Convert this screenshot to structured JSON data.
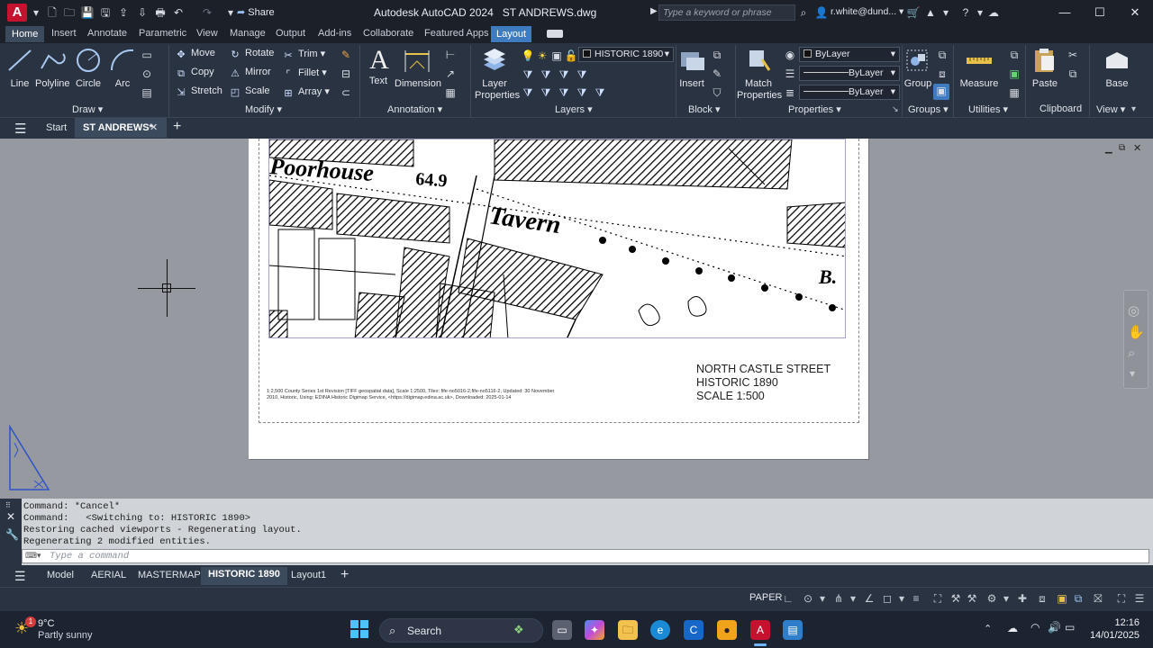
{
  "app": {
    "title": "Autodesk AutoCAD 2024",
    "filename": "ST ANDREWS.dwg",
    "logo_letter": "A",
    "share_label": "Share",
    "search_placeholder": "Type a keyword or phrase",
    "user": "r.white@dund..."
  },
  "ribbon_tabs": [
    "Home",
    "Insert",
    "Annotate",
    "Parametric",
    "View",
    "Manage",
    "Output",
    "Add-ins",
    "Collaborate",
    "Featured Apps",
    "Layout"
  ],
  "ribbon": {
    "draw": {
      "label": "Draw",
      "line": "Line",
      "polyline": "Polyline",
      "circle": "Circle",
      "arc": "Arc"
    },
    "modify": {
      "label": "Modify",
      "move": "Move",
      "rotate": "Rotate",
      "trim": "Trim",
      "copy": "Copy",
      "mirror": "Mirror",
      "fillet": "Fillet",
      "stretch": "Stretch",
      "scale": "Scale",
      "array": "Array"
    },
    "annotation": {
      "label": "Annotation",
      "text": "Text",
      "dimension": "Dimension"
    },
    "layers": {
      "label": "Layers",
      "layer_properties": "Layer Properties",
      "current_layer": "HISTORIC 1890"
    },
    "block": {
      "label": "Block",
      "insert": "Insert"
    },
    "properties": {
      "label": "Properties",
      "match": "Match Properties",
      "color": "ByLayer",
      "linetype": "ByLayer",
      "lineweight": "ByLayer"
    },
    "groups": {
      "label": "Groups",
      "group": "Group"
    },
    "utilities": {
      "label": "Utilities",
      "measure": "Measure"
    },
    "clipboard": {
      "label": "Clipboard",
      "paste": "Paste"
    },
    "view": {
      "label": "View",
      "base": "Base"
    }
  },
  "doc_tabs": {
    "start": "Start",
    "current": "ST ANDREWS*"
  },
  "map": {
    "poorhouse": "Poorhouse",
    "spot_height": "64.9",
    "tavern": "Tavern",
    "b_label": "B."
  },
  "sheet": {
    "credit_line1": "1:2,500 County Series 1st Revision [TIFF geospatial data], Scale 1:2500, Tiles: fife-no5016-2,fife-no5116-2, Updated: 30 November",
    "credit_line2": "2010, Historic, Using: EDINA Historic Digimap Service, <https://digimap.edina.ac.uk>, Downloaded: 2025-01-14",
    "title1": "NORTH CASTLE STREET",
    "title2": "HISTORIC 1890",
    "title3": "SCALE 1:500"
  },
  "command": {
    "history": [
      "Command: *Cancel*",
      "Command:   <Switching to: HISTORIC 1890>",
      "Restoring cached viewports - Regenerating layout.",
      "Regenerating 2 modified entities."
    ],
    "placeholder": "Type a command"
  },
  "layout_tabs": [
    "Model",
    "AERIAL",
    "MASTERMAP",
    "HISTORIC 1890",
    "Layout1"
  ],
  "status": {
    "space": "PAPER"
  },
  "taskbar": {
    "weather_temp": "9°C",
    "weather_desc": "Partly sunny",
    "weather_badge": "1",
    "search": "Search",
    "time": "12:16",
    "date": "14/01/2025"
  },
  "colors": {
    "accent": "#3f7bbf",
    "logo": "#c4122f",
    "paper": "#ffffff",
    "canvas": "#969aa0"
  }
}
